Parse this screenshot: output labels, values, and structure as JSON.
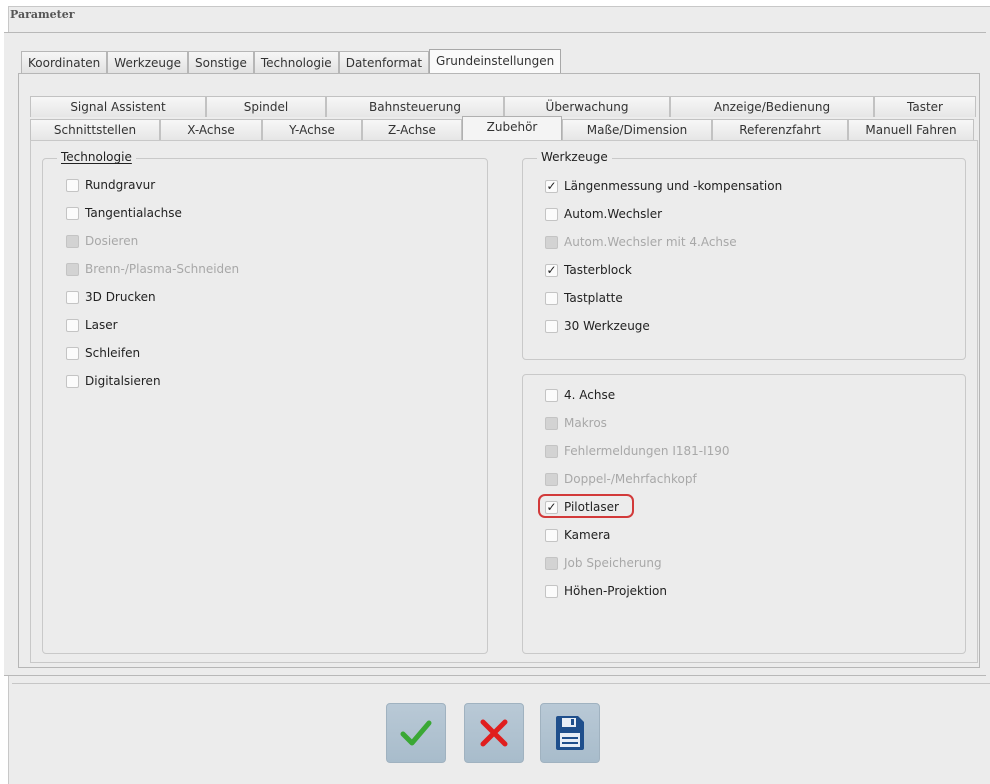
{
  "window": {
    "title": "Parameter"
  },
  "main_tabs": [
    {
      "label": "Koordinaten",
      "active": false
    },
    {
      "label": "Werkzeuge",
      "active": false
    },
    {
      "label": "Sonstige",
      "active": false
    },
    {
      "label": "Technologie",
      "active": false
    },
    {
      "label": "Datenformat",
      "active": false
    },
    {
      "label": "Grundeinstellungen",
      "active": true
    }
  ],
  "sub_tabs_row1": [
    "Signal Assistent",
    "Spindel",
    "Bahnsteuerung",
    "Überwachung",
    "Anzeige/Bedienung",
    "Taster"
  ],
  "sub_tabs_row2": [
    "Schnittstellen",
    "X-Achse",
    "Y-Achse",
    "Z-Achse",
    "Zubehör",
    "Maße/Dimension",
    "Referenzfahrt",
    "Manuell Fahren"
  ],
  "active_sub_tab": "Zubehör",
  "technologie": {
    "title": "Technologie",
    "items": [
      {
        "label": "Rundgravur",
        "checked": false,
        "disabled": false
      },
      {
        "label": "Tangentialachse",
        "checked": false,
        "disabled": false
      },
      {
        "label": "Dosieren",
        "checked": false,
        "disabled": true
      },
      {
        "label": "Brenn-/Plasma-Schneiden",
        "checked": false,
        "disabled": true
      },
      {
        "label": "3D Drucken",
        "checked": false,
        "disabled": false
      },
      {
        "label": "Laser",
        "checked": false,
        "disabled": false
      },
      {
        "label": "Schleifen",
        "checked": false,
        "disabled": false
      },
      {
        "label": "Digitalsieren",
        "checked": false,
        "disabled": false
      }
    ]
  },
  "werkzeuge": {
    "title": "Werkzeuge",
    "items": [
      {
        "label": "Längenmessung und -kompensation",
        "checked": true,
        "disabled": false
      },
      {
        "label": "Autom.Wechsler",
        "checked": false,
        "disabled": false
      },
      {
        "label": "Autom.Wechsler mit 4.Achse",
        "checked": false,
        "disabled": true
      },
      {
        "label": "Tasterblock",
        "checked": true,
        "disabled": false
      },
      {
        "label": "Tastplatte",
        "checked": false,
        "disabled": false
      },
      {
        "label": "30 Werkzeuge",
        "checked": false,
        "disabled": false
      }
    ]
  },
  "extras": {
    "items": [
      {
        "label": "4. Achse",
        "checked": false,
        "disabled": false
      },
      {
        "label": "Makros",
        "checked": false,
        "disabled": true
      },
      {
        "label": "Fehlermeldungen I181-I190",
        "checked": false,
        "disabled": true
      },
      {
        "label": "Doppel-/Mehrfachkopf",
        "checked": false,
        "disabled": true
      },
      {
        "label": "Pilotlaser",
        "checked": true,
        "disabled": false
      },
      {
        "label": "Kamera",
        "checked": false,
        "disabled": false
      },
      {
        "label": "Job Speicherung",
        "checked": false,
        "disabled": true
      },
      {
        "label": "Höhen-Projektion",
        "checked": false,
        "disabled": false
      }
    ]
  },
  "buttons": {
    "ok_icon": "checkmark-icon",
    "cancel_icon": "cross-icon",
    "save_icon": "floppy-disk-icon"
  },
  "colors": {
    "ok": "#3aa835",
    "cancel": "#e01e1e",
    "save": "#1f4f8c",
    "highlight": "#d23a3a"
  }
}
